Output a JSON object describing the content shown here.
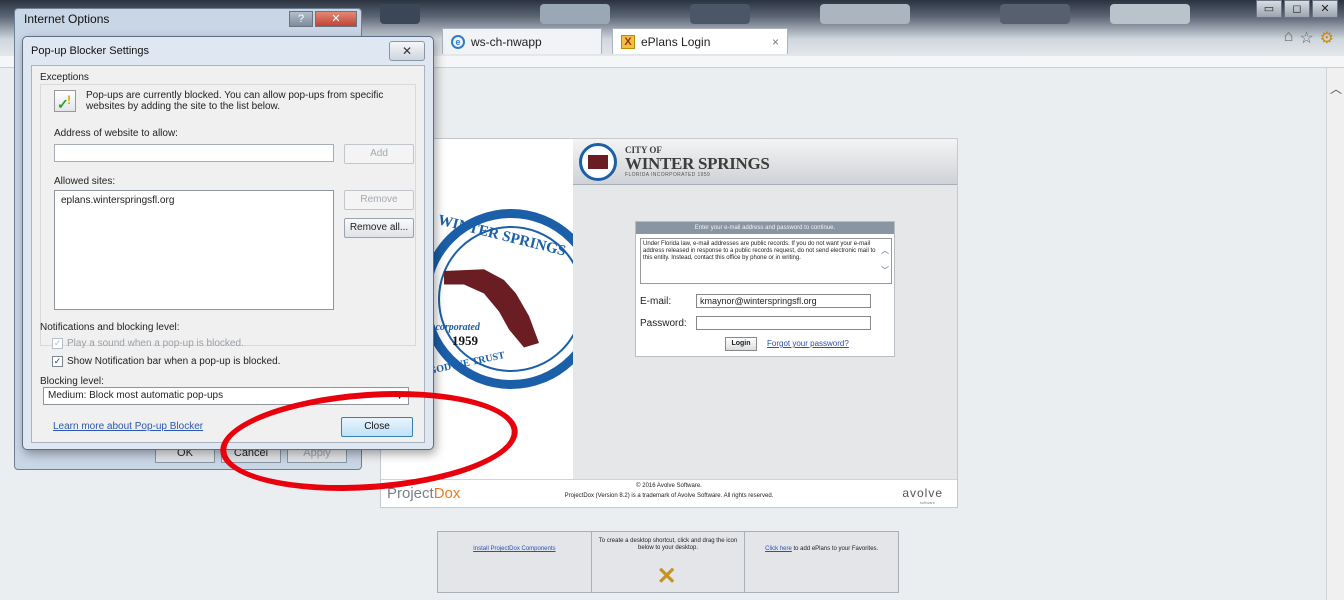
{
  "browser": {
    "tabs": [
      {
        "label": "ws-ch-nwapp",
        "icon": "ie-icon",
        "active": false
      },
      {
        "label": "ePlans Login",
        "icon": "projectdox-x-icon",
        "active": true
      }
    ],
    "tab_close_glyph": "×",
    "window_controls": {
      "minimize": "▭",
      "maximize": "◻",
      "close": "✕"
    },
    "fav_icons": [
      "home-icon",
      "star-icon",
      "gear-icon"
    ]
  },
  "internet_options": {
    "title": "Internet Options",
    "help_glyph": "?",
    "close_glyph": "✕",
    "buttons": {
      "ok": "OK",
      "cancel": "Cancel",
      "apply": "Apply"
    }
  },
  "popup_blocker": {
    "title": "Pop-up Blocker Settings",
    "close_glyph": "✕",
    "exceptions_label": "Exceptions",
    "info_text": "Pop-ups are currently blocked.  You can allow pop-ups from specific websites by adding the site to the list below.",
    "address_label": "Address of website to allow:",
    "address_value": "",
    "add_button": "Add",
    "allowed_label": "Allowed sites:",
    "allowed_sites": [
      "eplans.winterspringsfl.org"
    ],
    "remove_button": "Remove",
    "remove_all_button": "Remove all...",
    "notifications_label": "Notifications and blocking level:",
    "play_sound_label": "Play a sound when a pop-up is blocked.",
    "play_sound_checked": true,
    "show_bar_label": "Show Notification bar when a pop-up is blocked.",
    "show_bar_checked": true,
    "blocking_level_label": "Blocking level:",
    "blocking_level_value": "Medium: Block most automatic pop-ups",
    "learn_more": "Learn more about Pop-up Blocker",
    "close_button": "Close"
  },
  "eplans": {
    "seal": {
      "top": "WINTER SPRINGS",
      "incorporated": "Incorporated",
      "year": "1959",
      "motto": "GOD WE TRUST"
    },
    "banner": {
      "city_of": "CITY OF",
      "name": "WINTER SPRINGS",
      "sub": "FLORIDA INCORPORATED 1959"
    },
    "login": {
      "header": "Enter your e-mail address and password to continue.",
      "legal": "Under Florida law, e-mail addresses are public records. If you do not want your e-mail address released in response to a public records request, do not send electronic mail to this entity. Instead, contact this office by phone or in writing.",
      "email_label": "E-mail:",
      "email_value": "kmaynor@winterspringsfl.org",
      "password_label": "Password:",
      "password_value": "",
      "login_button": "Login",
      "forgot_link": "Forgot your password?"
    },
    "footer": {
      "brand_a": "Project",
      "brand_b": "Dox",
      "copyright": "© 2016 Avolve Software.",
      "trademark": "ProjectDox (Version 8.2) is a trademark of Avolve Software. All rights reserved.",
      "avolve": "avolve",
      "avolve_sub": "software"
    },
    "components": {
      "install": "Install ProjectDox Components",
      "shortcut": "To create a desktop shortcut, click and drag the icon below to your desktop.",
      "fav_link": "Click here",
      "fav_text": " to add ePlans to your Favorites."
    }
  },
  "colors": {
    "annotation": "#e8000d",
    "link": "#2a4fb0",
    "seal_blue": "#1b5fa8",
    "florida_maroon": "#6a1e24"
  }
}
